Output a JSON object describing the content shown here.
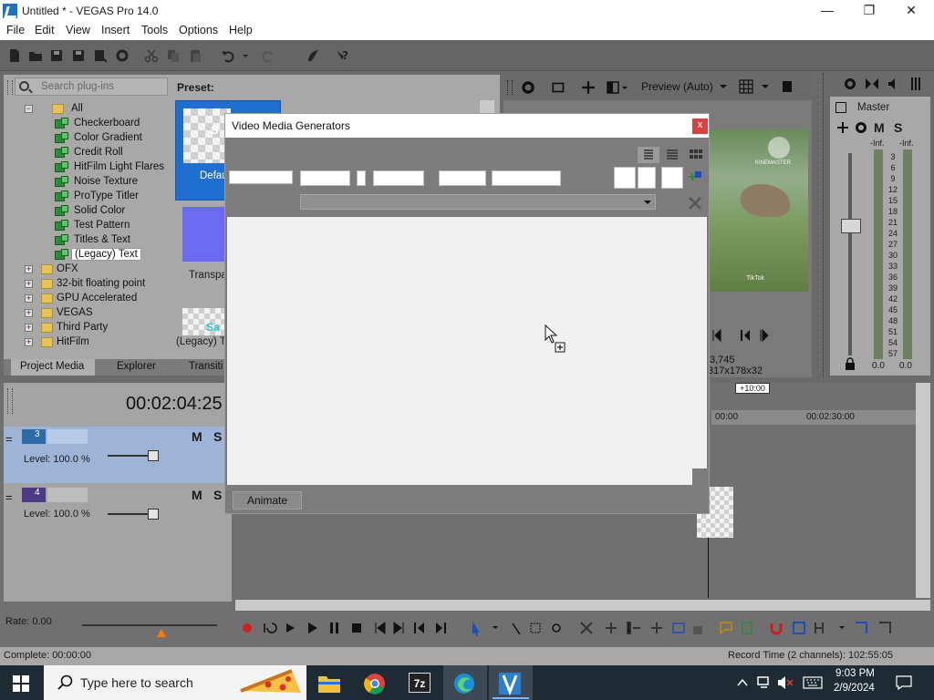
{
  "window": {
    "title": "Untitled * - VEGAS Pro 14.0",
    "min": "—",
    "max": "❐",
    "close": "✕"
  },
  "menu": [
    "File",
    "Edit",
    "View",
    "Insert",
    "Tools",
    "Options",
    "Help"
  ],
  "plugins": {
    "search_placeholder": "Search plug-ins",
    "tree": [
      {
        "label": "All",
        "type": "folder",
        "level": 0,
        "expanded": true
      },
      {
        "label": "Checkerboard",
        "type": "plugin",
        "level": 1
      },
      {
        "label": "Color Gradient",
        "type": "plugin",
        "level": 1
      },
      {
        "label": "Credit Roll",
        "type": "plugin",
        "level": 1
      },
      {
        "label": "HitFilm Light Flares",
        "type": "plugin",
        "level": 1
      },
      {
        "label": "Noise Texture",
        "type": "plugin",
        "level": 1
      },
      {
        "label": "ProType Titler",
        "type": "plugin",
        "level": 1
      },
      {
        "label": "Solid Color",
        "type": "plugin",
        "level": 1
      },
      {
        "label": "Test Pattern",
        "type": "plugin",
        "level": 1
      },
      {
        "label": "Titles & Text",
        "type": "plugin",
        "level": 1
      },
      {
        "label": "(Legacy) Text",
        "type": "plugin",
        "level": 1,
        "selected": true
      },
      {
        "label": "OFX",
        "type": "folder",
        "level": 0
      },
      {
        "label": "32-bit floating point",
        "type": "folder",
        "level": 0
      },
      {
        "label": "GPU Accelerated",
        "type": "folder",
        "level": 0
      },
      {
        "label": "VEGAS",
        "type": "folder",
        "level": 0
      },
      {
        "label": "Third Party",
        "type": "folder",
        "level": 0
      },
      {
        "label": "HitFilm",
        "type": "folder",
        "level": 0
      }
    ],
    "tabs": [
      "Project Media",
      "Explorer",
      "Transiti"
    ]
  },
  "preset": {
    "label": "Preset:",
    "items": [
      "Defau",
      "Transpa",
      "(Legacy) Te"
    ],
    "thumb_text_1": "S",
    "thumb_text_3": "Sa"
  },
  "preview": {
    "mode": "Preview (Auto)",
    "frame_info": "3,745",
    "resolution": "317x178x32",
    "watermark": "KINEMASTER",
    "tiktok": "TikTok"
  },
  "mixer": {
    "title": "Master",
    "inf_left": "-Inf.",
    "inf_right": "-Inf.",
    "scale": [
      "3",
      "6",
      "9",
      "12",
      "15",
      "18",
      "21",
      "24",
      "27",
      "30",
      "33",
      "36",
      "39",
      "42",
      "45",
      "48",
      "51",
      "54",
      "57"
    ],
    "bottom_left": "0.0",
    "bottom_right": "0.0"
  },
  "timeline": {
    "timecode": "00:02:04:25",
    "tracks": [
      {
        "number": "3",
        "level": "Level: 100.0 %"
      },
      {
        "number": "4",
        "level": "Level: 100.0 %"
      }
    ],
    "ruler": [
      "00:00",
      "00:02:30:00"
    ],
    "offset_badge": "+10:00",
    "rate": "Rate: 0.00"
  },
  "status": {
    "complete": "Complete: 00:00:00",
    "record_time": "Record Time (2 channels): 102:55:05"
  },
  "dialog": {
    "title": "Video Media Generators",
    "close": "x",
    "animate": "Animate"
  },
  "taskbar": {
    "search_placeholder": "Type here to search",
    "time": "9:03 PM",
    "date": "2/9/2024"
  }
}
